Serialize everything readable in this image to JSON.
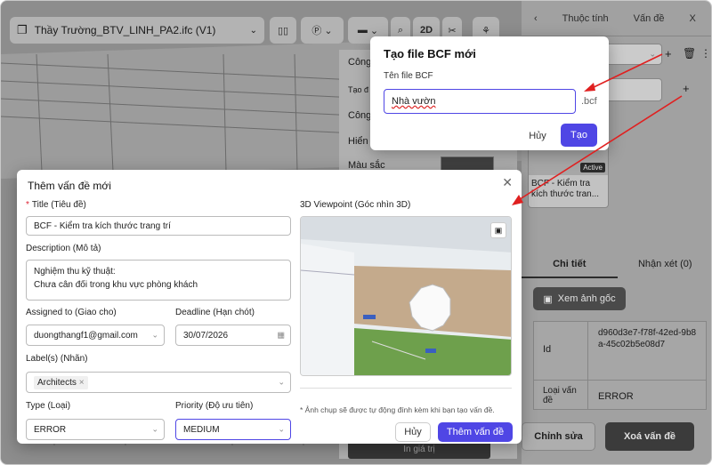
{
  "header": {
    "file_title": "Thầy Trường_BTV_LINH_PA2.ifc (V1)",
    "tool_2d": "2D"
  },
  "right_panel": {
    "tabs": [
      "Thuộc tính",
      "Vấn đề",
      "X"
    ],
    "card_title": "BCF - Kiểm tra kích thước tran...",
    "card_badge": "Active",
    "detail_tabs": [
      "Chi tiết",
      "Nhận xét (0)"
    ],
    "view_image_button": "Xem ảnh gốc",
    "id_label": "Id",
    "id_value": "d960d3e7-f78f-42ed-9b8a-45c02b5e08d7",
    "type_label": "Loại vấn đề",
    "type_value": "ERROR",
    "edit_button": "Chỉnh sửa",
    "delete_button": "Xoá vấn đề"
  },
  "behind_panel": {
    "rows": [
      "Công",
      "Tạo đ",
      "Công",
      "Hiển",
      "Màu sắc"
    ],
    "bottom_text": "In giá trị"
  },
  "bcf_dialog": {
    "title": "Tạo file BCF mới",
    "field_label": "Tên file BCF",
    "field_value": "Nhà vườn",
    "suffix": ".bcf",
    "cancel": "Hủy",
    "create": "Tạo"
  },
  "issue_dialog": {
    "title": "Thêm vấn đề mới",
    "title_label": "Title (Tiêu đề)",
    "title_value": "BCF - Kiểm tra kích thước trang trí",
    "description_label": "Description (Mô tả)",
    "description_line1": "Nghiệm thu kỹ thuật:",
    "description_line2": "Chưa cân đối trong khu vực phòng khách",
    "assigned_label": "Assigned to (Giao cho)",
    "assigned_value": "duongthangf1@gmail.com",
    "deadline_label": "Deadline (Hạn chót)",
    "deadline_value": "30/07/2026",
    "labels_label": "Label(s) (Nhãn)",
    "label_tag": "Architects",
    "type_label": "Type (Loại)",
    "type_value": "ERROR",
    "priority_label": "Priority (Độ ưu tiên)",
    "priority_value": "MEDIUM",
    "viewpoint_label": "3D Viewpoint (Góc nhìn 3D)",
    "note": "* Ảnh chụp sẽ được tự động đính kèm khi bạn tạo vấn đề.",
    "cancel": "Hủy",
    "submit": "Thêm vấn đề"
  },
  "colors": {
    "accent": "#4f46e5",
    "danger_arrow": "#e02020",
    "dark_button": "#444444"
  }
}
